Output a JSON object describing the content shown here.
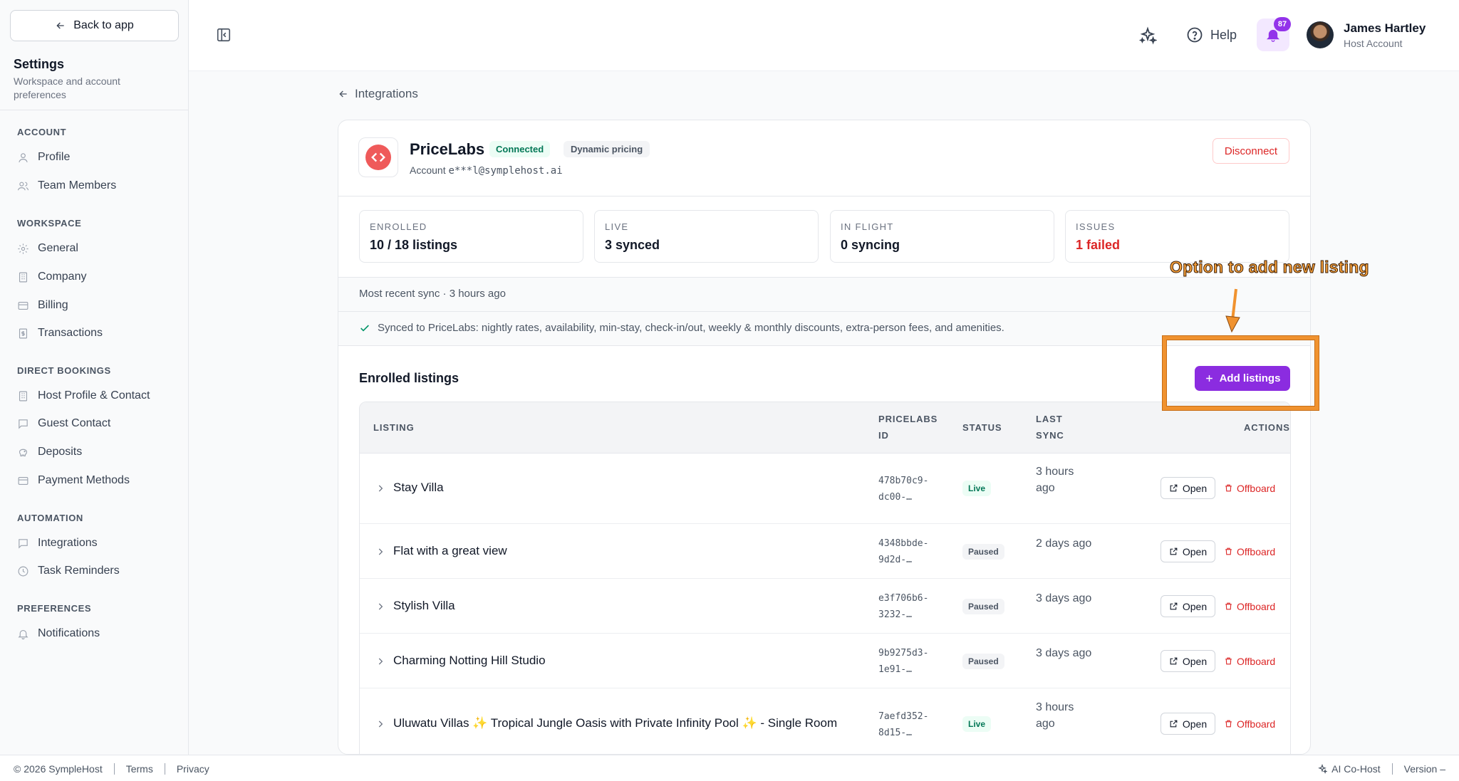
{
  "sidebar": {
    "back_label": "Back to app",
    "title": "Settings",
    "subtitle": "Workspace and account preferences",
    "sections": [
      {
        "label": "ACCOUNT",
        "items": [
          "Profile",
          "Team Members"
        ]
      },
      {
        "label": "WORKSPACE",
        "items": [
          "General",
          "Company",
          "Billing",
          "Transactions"
        ]
      },
      {
        "label": "DIRECT BOOKINGS",
        "items": [
          "Host Profile & Contact",
          "Guest Contact",
          "Deposits",
          "Payment Methods"
        ]
      },
      {
        "label": "AUTOMATION",
        "items": [
          "Integrations",
          "Task Reminders"
        ]
      },
      {
        "label": "PREFERENCES",
        "items": [
          "Notifications"
        ]
      }
    ]
  },
  "topbar": {
    "help_label": "Help",
    "notification_count": "87",
    "user_name": "James Hartley",
    "user_role": "Host Account"
  },
  "breadcrumb": {
    "label": "Integrations"
  },
  "integration": {
    "name": "PriceLabs",
    "status_pill": "Connected",
    "tag_pill": "Dynamic pricing",
    "account_prefix": "Account",
    "account_email": "e***l@symplehost.ai",
    "disconnect_label": "Disconnect"
  },
  "stats": [
    {
      "label": "ENROLLED",
      "value": "10 / 18 listings",
      "tone": "normal"
    },
    {
      "label": "LIVE",
      "value": "3 synced",
      "tone": "normal"
    },
    {
      "label": "IN FLIGHT",
      "value": "0 syncing",
      "tone": "normal"
    },
    {
      "label": "ISSUES",
      "value": "1 failed",
      "tone": "error"
    }
  ],
  "sync": {
    "recent": "Most recent sync · 3 hours ago",
    "synced_fields": "Synced to PriceLabs: nightly rates, availability, min-stay, check-in/out, weekly & monthly discounts, extra-person fees, and amenities."
  },
  "enrolled": {
    "title": "Enrolled listings",
    "add_label": "Add listings"
  },
  "table": {
    "headers": {
      "listing": "LISTING",
      "pricelabs_id": "PRICELABS ID",
      "status": "STATUS",
      "last_sync": "LAST SYNC",
      "actions": "ACTIONS"
    },
    "open_label": "Open",
    "offboard_label": "Offboard",
    "rows": [
      {
        "name": "Stay Villa",
        "id": "478b70c9-dc00-…",
        "status": "Live",
        "last_sync": "3 hours ago"
      },
      {
        "name": "Flat with a great view",
        "id": "4348bbde-9d2d-…",
        "status": "Paused",
        "last_sync": "2 days ago"
      },
      {
        "name": "Stylish Villa",
        "id": "e3f706b6-3232-…",
        "status": "Paused",
        "last_sync": "3 days ago"
      },
      {
        "name": "Charming Notting Hill Studio",
        "id": "9b9275d3-1e91-…",
        "status": "Paused",
        "last_sync": "3 days ago"
      },
      {
        "name": "Uluwatu Villas ✨ Tropical Jungle Oasis with Private Infinity Pool ✨ - Single Room",
        "id": "7aefd352-8d15-…",
        "status": "Live",
        "last_sync": "3 hours ago"
      }
    ]
  },
  "annotation": {
    "text": "Option to add new listing"
  },
  "footer": {
    "copyright": "© 2026 SympleHost",
    "terms": "Terms",
    "privacy": "Privacy",
    "cohost": "AI Co-Host",
    "version": "Version –"
  },
  "colors": {
    "accent": "#8b2ce0",
    "danger": "#dc2626",
    "success": "#047857",
    "annotation": "#f0922f"
  }
}
